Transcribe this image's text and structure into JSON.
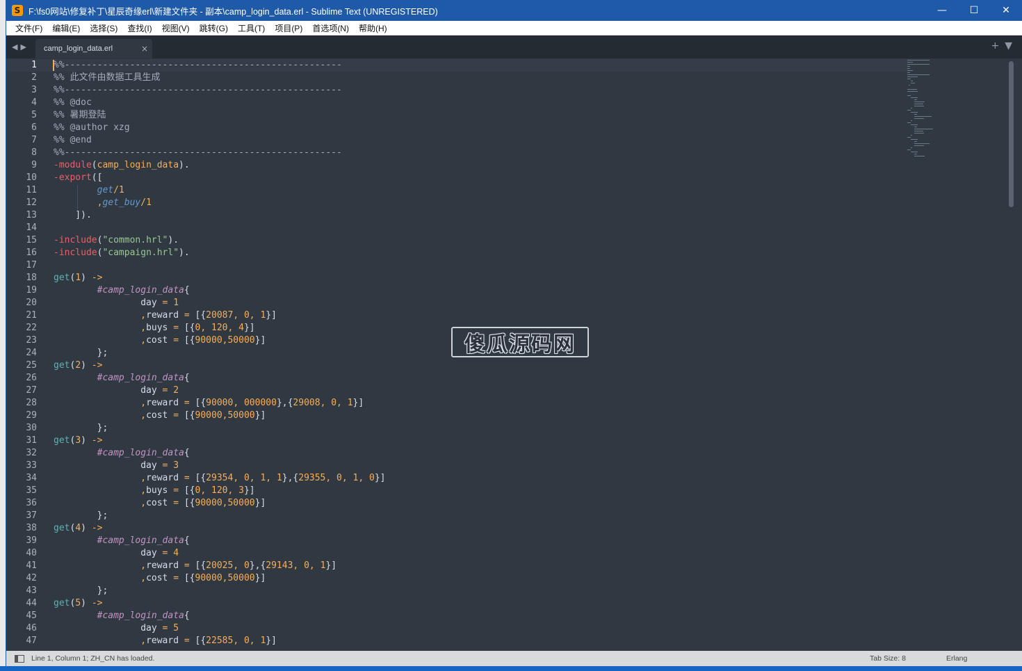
{
  "window": {
    "title": "F:\\fs0网站\\修复补丁\\星辰奇缘erl\\新建文件夹 - 副本\\camp_login_data.erl - Sublime Text (UNREGISTERED)",
    "app_icon_glyph": "S",
    "minimize_glyph": "—",
    "maximize_glyph": "☐",
    "close_glyph": "✕"
  },
  "menu": [
    "文件(F)",
    "编辑(E)",
    "选择(S)",
    "查找(I)",
    "视图(V)",
    "跳转(G)",
    "工具(T)",
    "项目(P)",
    "首选项(N)",
    "帮助(H)"
  ],
  "tabs": {
    "nav_glyph": "◀▶",
    "active": "camp_login_data.erl",
    "close_glyph": "×",
    "new_tab_glyph": "+",
    "tab_menu_glyph": "▼"
  },
  "editor": {
    "current_line": 1,
    "lines": [
      [
        [
          "c-cm",
          "%%---------------------------------------------------"
        ]
      ],
      [
        [
          "c-cm",
          "%% 此文件由数据工具生成"
        ]
      ],
      [
        [
          "c-cm",
          "%%---------------------------------------------------"
        ]
      ],
      [
        [
          "c-cm",
          "%% @doc"
        ]
      ],
      [
        [
          "c-cm",
          "%% 暑期登陆"
        ]
      ],
      [
        [
          "c-cm",
          "%% @author xzg"
        ]
      ],
      [
        [
          "c-cm",
          "%% @end"
        ]
      ],
      [
        [
          "c-cm",
          "%%---------------------------------------------------"
        ]
      ],
      [
        [
          "c-kw",
          "-module"
        ],
        [
          "c-nm",
          "("
        ],
        [
          "c-num",
          "camp_login_data"
        ],
        [
          "c-nm",
          ")."
        ]
      ],
      [
        [
          "c-kw",
          "-export"
        ],
        [
          "c-nm",
          "(["
        ]
      ],
      [
        [
          "c-nm",
          "        "
        ],
        [
          "c-atom",
          "get"
        ],
        [
          "c-op",
          "/"
        ],
        [
          "c-num",
          "1"
        ]
      ],
      [
        [
          "c-nm",
          "        "
        ],
        [
          "c-op",
          ","
        ],
        [
          "c-atom",
          "get_buy"
        ],
        [
          "c-op",
          "/"
        ],
        [
          "c-num",
          "1"
        ]
      ],
      [
        [
          "c-nm",
          "    ])."
        ]
      ],
      [
        [
          "c-nm",
          ""
        ]
      ],
      [
        [
          "c-kw",
          "-include"
        ],
        [
          "c-nm",
          "("
        ],
        [
          "c-str",
          "\"common.hrl\""
        ],
        [
          "c-nm",
          ")."
        ]
      ],
      [
        [
          "c-kw",
          "-include"
        ],
        [
          "c-nm",
          "("
        ],
        [
          "c-str",
          "\"campaign.hrl\""
        ],
        [
          "c-nm",
          ")."
        ]
      ],
      [
        [
          "c-nm",
          ""
        ]
      ],
      [
        [
          "c-fn",
          "get"
        ],
        [
          "c-nm",
          "("
        ],
        [
          "c-num",
          "1"
        ],
        [
          "c-nm",
          ") "
        ],
        [
          "c-op",
          "->"
        ]
      ],
      [
        [
          "c-nm",
          "        "
        ],
        [
          "c-rec",
          "#camp_login_data"
        ],
        [
          "c-nm",
          "{"
        ]
      ],
      [
        [
          "c-nm",
          "                day "
        ],
        [
          "c-op",
          "="
        ],
        [
          "c-nm",
          " "
        ],
        [
          "c-num",
          "1"
        ]
      ],
      [
        [
          "c-nm",
          "                "
        ],
        [
          "c-op",
          ","
        ],
        [
          "c-nm",
          "reward "
        ],
        [
          "c-op",
          "="
        ],
        [
          "c-nm",
          " [{"
        ],
        [
          "c-num",
          "20087"
        ],
        [
          "c-op",
          ","
        ],
        [
          "c-nm",
          " "
        ],
        [
          "c-num",
          "0"
        ],
        [
          "c-op",
          ","
        ],
        [
          "c-nm",
          " "
        ],
        [
          "c-num",
          "1"
        ],
        [
          "c-nm",
          "}]"
        ]
      ],
      [
        [
          "c-nm",
          "                "
        ],
        [
          "c-op",
          ","
        ],
        [
          "c-nm",
          "buys "
        ],
        [
          "c-op",
          "="
        ],
        [
          "c-nm",
          " [{"
        ],
        [
          "c-num",
          "0"
        ],
        [
          "c-op",
          ","
        ],
        [
          "c-nm",
          " "
        ],
        [
          "c-num",
          "120"
        ],
        [
          "c-op",
          ","
        ],
        [
          "c-nm",
          " "
        ],
        [
          "c-num",
          "4"
        ],
        [
          "c-nm",
          "}]"
        ]
      ],
      [
        [
          "c-nm",
          "                "
        ],
        [
          "c-op",
          ","
        ],
        [
          "c-nm",
          "cost "
        ],
        [
          "c-op",
          "="
        ],
        [
          "c-nm",
          " [{"
        ],
        [
          "c-num",
          "90000"
        ],
        [
          "c-op",
          ","
        ],
        [
          "c-num",
          "50000"
        ],
        [
          "c-nm",
          "}]"
        ]
      ],
      [
        [
          "c-nm",
          "        };"
        ]
      ],
      [
        [
          "c-fn",
          "get"
        ],
        [
          "c-nm",
          "("
        ],
        [
          "c-num",
          "2"
        ],
        [
          "c-nm",
          ") "
        ],
        [
          "c-op",
          "->"
        ]
      ],
      [
        [
          "c-nm",
          "        "
        ],
        [
          "c-rec",
          "#camp_login_data"
        ],
        [
          "c-nm",
          "{"
        ]
      ],
      [
        [
          "c-nm",
          "                day "
        ],
        [
          "c-op",
          "="
        ],
        [
          "c-nm",
          " "
        ],
        [
          "c-num",
          "2"
        ]
      ],
      [
        [
          "c-nm",
          "                "
        ],
        [
          "c-op",
          ","
        ],
        [
          "c-nm",
          "reward "
        ],
        [
          "c-op",
          "="
        ],
        [
          "c-nm",
          " [{"
        ],
        [
          "c-num",
          "90000"
        ],
        [
          "c-op",
          ","
        ],
        [
          "c-nm",
          " "
        ],
        [
          "c-num",
          "000000"
        ],
        [
          "c-nm",
          "},{"
        ],
        [
          "c-num",
          "29008"
        ],
        [
          "c-op",
          ","
        ],
        [
          "c-nm",
          " "
        ],
        [
          "c-num",
          "0"
        ],
        [
          "c-op",
          ","
        ],
        [
          "c-nm",
          " "
        ],
        [
          "c-num",
          "1"
        ],
        [
          "c-nm",
          "}]"
        ]
      ],
      [
        [
          "c-nm",
          "                "
        ],
        [
          "c-op",
          ","
        ],
        [
          "c-nm",
          "cost "
        ],
        [
          "c-op",
          "="
        ],
        [
          "c-nm",
          " [{"
        ],
        [
          "c-num",
          "90000"
        ],
        [
          "c-op",
          ","
        ],
        [
          "c-num",
          "50000"
        ],
        [
          "c-nm",
          "}]"
        ]
      ],
      [
        [
          "c-nm",
          "        };"
        ]
      ],
      [
        [
          "c-fn",
          "get"
        ],
        [
          "c-nm",
          "("
        ],
        [
          "c-num",
          "3"
        ],
        [
          "c-nm",
          ") "
        ],
        [
          "c-op",
          "->"
        ]
      ],
      [
        [
          "c-nm",
          "        "
        ],
        [
          "c-rec",
          "#camp_login_data"
        ],
        [
          "c-nm",
          "{"
        ]
      ],
      [
        [
          "c-nm",
          "                day "
        ],
        [
          "c-op",
          "="
        ],
        [
          "c-nm",
          " "
        ],
        [
          "c-num",
          "3"
        ]
      ],
      [
        [
          "c-nm",
          "                "
        ],
        [
          "c-op",
          ","
        ],
        [
          "c-nm",
          "reward "
        ],
        [
          "c-op",
          "="
        ],
        [
          "c-nm",
          " [{"
        ],
        [
          "c-num",
          "29354"
        ],
        [
          "c-op",
          ","
        ],
        [
          "c-nm",
          " "
        ],
        [
          "c-num",
          "0"
        ],
        [
          "c-op",
          ","
        ],
        [
          "c-nm",
          " "
        ],
        [
          "c-num",
          "1"
        ],
        [
          "c-op",
          ","
        ],
        [
          "c-nm",
          " "
        ],
        [
          "c-num",
          "1"
        ],
        [
          "c-nm",
          "},{"
        ],
        [
          "c-num",
          "29355"
        ],
        [
          "c-op",
          ","
        ],
        [
          "c-nm",
          " "
        ],
        [
          "c-num",
          "0"
        ],
        [
          "c-op",
          ","
        ],
        [
          "c-nm",
          " "
        ],
        [
          "c-num",
          "1"
        ],
        [
          "c-op",
          ","
        ],
        [
          "c-nm",
          " "
        ],
        [
          "c-num",
          "0"
        ],
        [
          "c-nm",
          "}]"
        ]
      ],
      [
        [
          "c-nm",
          "                "
        ],
        [
          "c-op",
          ","
        ],
        [
          "c-nm",
          "buys "
        ],
        [
          "c-op",
          "="
        ],
        [
          "c-nm",
          " [{"
        ],
        [
          "c-num",
          "0"
        ],
        [
          "c-op",
          ","
        ],
        [
          "c-nm",
          " "
        ],
        [
          "c-num",
          "120"
        ],
        [
          "c-op",
          ","
        ],
        [
          "c-nm",
          " "
        ],
        [
          "c-num",
          "3"
        ],
        [
          "c-nm",
          "}]"
        ]
      ],
      [
        [
          "c-nm",
          "                "
        ],
        [
          "c-op",
          ","
        ],
        [
          "c-nm",
          "cost "
        ],
        [
          "c-op",
          "="
        ],
        [
          "c-nm",
          " [{"
        ],
        [
          "c-num",
          "90000"
        ],
        [
          "c-op",
          ","
        ],
        [
          "c-num",
          "50000"
        ],
        [
          "c-nm",
          "}]"
        ]
      ],
      [
        [
          "c-nm",
          "        };"
        ]
      ],
      [
        [
          "c-fn",
          "get"
        ],
        [
          "c-nm",
          "("
        ],
        [
          "c-num",
          "4"
        ],
        [
          "c-nm",
          ") "
        ],
        [
          "c-op",
          "->"
        ]
      ],
      [
        [
          "c-nm",
          "        "
        ],
        [
          "c-rec",
          "#camp_login_data"
        ],
        [
          "c-nm",
          "{"
        ]
      ],
      [
        [
          "c-nm",
          "                day "
        ],
        [
          "c-op",
          "="
        ],
        [
          "c-nm",
          " "
        ],
        [
          "c-num",
          "4"
        ]
      ],
      [
        [
          "c-nm",
          "                "
        ],
        [
          "c-op",
          ","
        ],
        [
          "c-nm",
          "reward "
        ],
        [
          "c-op",
          "="
        ],
        [
          "c-nm",
          " [{"
        ],
        [
          "c-num",
          "20025"
        ],
        [
          "c-op",
          ","
        ],
        [
          "c-nm",
          " "
        ],
        [
          "c-num",
          "0"
        ],
        [
          "c-nm",
          "},{"
        ],
        [
          "c-num",
          "29143"
        ],
        [
          "c-op",
          ","
        ],
        [
          "c-nm",
          " "
        ],
        [
          "c-num",
          "0"
        ],
        [
          "c-op",
          ","
        ],
        [
          "c-nm",
          " "
        ],
        [
          "c-num",
          "1"
        ],
        [
          "c-nm",
          "}]"
        ]
      ],
      [
        [
          "c-nm",
          "                "
        ],
        [
          "c-op",
          ","
        ],
        [
          "c-nm",
          "cost "
        ],
        [
          "c-op",
          "="
        ],
        [
          "c-nm",
          " [{"
        ],
        [
          "c-num",
          "90000"
        ],
        [
          "c-op",
          ","
        ],
        [
          "c-num",
          "50000"
        ],
        [
          "c-nm",
          "}]"
        ]
      ],
      [
        [
          "c-nm",
          "        };"
        ]
      ],
      [
        [
          "c-fn",
          "get"
        ],
        [
          "c-nm",
          "("
        ],
        [
          "c-num",
          "5"
        ],
        [
          "c-nm",
          ") "
        ],
        [
          "c-op",
          "->"
        ]
      ],
      [
        [
          "c-nm",
          "        "
        ],
        [
          "c-rec",
          "#camp_login_data"
        ],
        [
          "c-nm",
          "{"
        ]
      ],
      [
        [
          "c-nm",
          "                day "
        ],
        [
          "c-op",
          "="
        ],
        [
          "c-nm",
          " "
        ],
        [
          "c-num",
          "5"
        ]
      ],
      [
        [
          "c-nm",
          "                "
        ],
        [
          "c-op",
          ","
        ],
        [
          "c-nm",
          "reward "
        ],
        [
          "c-op",
          "="
        ],
        [
          "c-nm",
          " [{"
        ],
        [
          "c-num",
          "22585"
        ],
        [
          "c-op",
          ","
        ],
        [
          "c-nm",
          " "
        ],
        [
          "c-num",
          "0"
        ],
        [
          "c-op",
          ","
        ],
        [
          "c-nm",
          " "
        ],
        [
          "c-num",
          "1"
        ],
        [
          "c-nm",
          "}]"
        ]
      ]
    ]
  },
  "watermark": "傻瓜源码网",
  "status": {
    "message": "Line 1, Column 1; ZH_CN has loaded.",
    "tab_size": "Tab Size: 8",
    "syntax": "Erlang"
  }
}
